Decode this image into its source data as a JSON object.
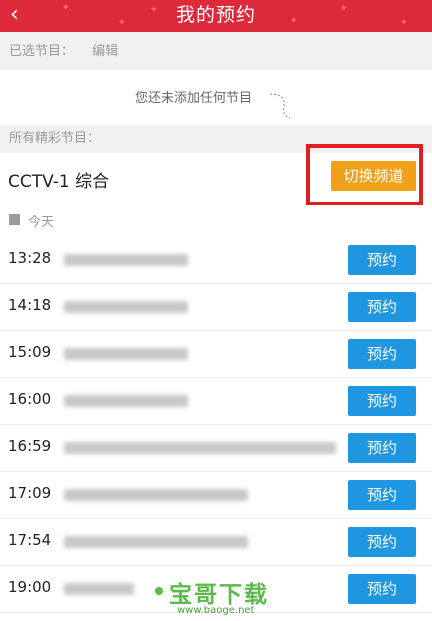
{
  "header": {
    "title": "我的预约",
    "back_icon": "chevron-left-icon",
    "color": "#dd2a3b"
  },
  "selected": {
    "label": "已选节目：",
    "edit": "编辑",
    "empty_text": "您还未添加任何节目"
  },
  "all_programs": {
    "label": "所有精彩节目："
  },
  "channel": {
    "name": "CCTV-1 综合",
    "switch_label": "切换频道",
    "switch_color": "#f0a019"
  },
  "day": {
    "label": "今天"
  },
  "programs": [
    {
      "time": "13:28",
      "button": "预约"
    },
    {
      "time": "14:18",
      "button": "预约"
    },
    {
      "time": "15:09",
      "button": "预约"
    },
    {
      "time": "16:00",
      "button": "预约"
    },
    {
      "time": "16:59",
      "button": "预约"
    },
    {
      "time": "17:09",
      "button": "预约"
    },
    {
      "time": "17:54",
      "button": "预约"
    },
    {
      "time": "19:00",
      "button": "预约"
    }
  ],
  "watermark": {
    "text": "宝哥下载",
    "url": "www.baoge.net"
  },
  "colors": {
    "reserve_button": "#1e97e0",
    "highlight_border": "#e02020"
  }
}
